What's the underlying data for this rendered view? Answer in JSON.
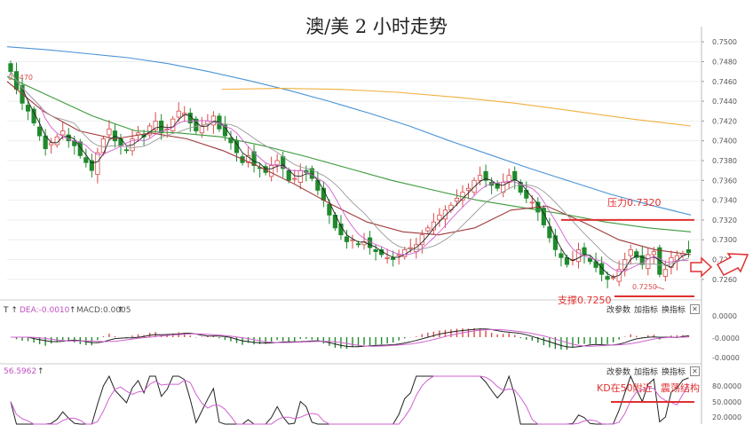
{
  "title": "澳/美 2 小时走势",
  "colors": {
    "up": "#d84a4a",
    "down": "#1f8a2c",
    "red_line": "#e03030",
    "ma_blue": "#4a93d6",
    "ma_orange": "#f0b040",
    "ma_green": "#3a9a3a",
    "ma_darkred": "#a03a3a",
    "ma_pink": "#d060d0",
    "ma_black": "#222222",
    "ma_gray": "#999999"
  },
  "price_panel": {
    "left_label": "0.7470",
    "y_ticks": [
      "0.7500",
      "0.7480",
      "0.7460",
      "0.7440",
      "0.7420",
      "0.7400",
      "0.7380",
      "0.7360",
      "0.7340",
      "0.7320",
      "0.7300",
      "0.7280",
      "0.7260"
    ],
    "resistance_label": "压力0.7320",
    "support_label": "支撑0.7250",
    "low_label": "0.7250"
  },
  "macd_panel": {
    "header": {
      "dea": "DEA:-0.0010",
      "macd": "MACD:0.0005"
    },
    "y_ticks": [
      "0.0000",
      "-0.0000",
      "-0.0000"
    ],
    "toolbar": {
      "params": "改参数",
      "add": "加指标",
      "swap": "换指标",
      "close": "✕"
    }
  },
  "kd_panel": {
    "header_value": "56.5962",
    "y_ticks": [
      "80.0000",
      "50.0000",
      "20.0000"
    ],
    "annotation_kd": "KD在50附近",
    "annotation_range": "震荡结构",
    "toolbar": {
      "params": "改参数",
      "add": "加指标",
      "swap": "换指标",
      "close": "✕"
    }
  },
  "chart_data": [
    {
      "type": "candlestick",
      "title": "澳/美 2 小时走势",
      "ylim": [
        0.725,
        0.751
      ],
      "close": [
        0.747,
        0.7452,
        0.7438,
        0.743,
        0.7418,
        0.7405,
        0.7392,
        0.7398,
        0.7404,
        0.741,
        0.74,
        0.7395,
        0.7385,
        0.7378,
        0.737,
        0.7388,
        0.7402,
        0.7412,
        0.74,
        0.7395,
        0.739,
        0.7402,
        0.7408,
        0.7404,
        0.7415,
        0.742,
        0.7408,
        0.7412,
        0.7422,
        0.743,
        0.7428,
        0.7418,
        0.741,
        0.7415,
        0.742,
        0.7425,
        0.7412,
        0.7405,
        0.7398,
        0.7388,
        0.7378,
        0.7385,
        0.7375,
        0.7372,
        0.7368,
        0.7375,
        0.738,
        0.7372,
        0.736,
        0.7362,
        0.737,
        0.7368,
        0.7362,
        0.735,
        0.734,
        0.7325,
        0.7312,
        0.7305,
        0.7298,
        0.73,
        0.7295,
        0.7298,
        0.7292,
        0.7288,
        0.7285,
        0.7282,
        0.728,
        0.7285,
        0.729,
        0.7292,
        0.7295,
        0.7305,
        0.7312,
        0.7318,
        0.7325,
        0.733,
        0.7335,
        0.7342,
        0.7348,
        0.7352,
        0.736,
        0.7365,
        0.736,
        0.7355,
        0.7352,
        0.7358,
        0.7365,
        0.736,
        0.7348,
        0.7342,
        0.7338,
        0.7328,
        0.7315,
        0.7302,
        0.729,
        0.7282,
        0.7275,
        0.728,
        0.729,
        0.7285,
        0.7278,
        0.7272,
        0.7265,
        0.726,
        0.7262,
        0.727,
        0.728,
        0.729,
        0.7282,
        0.7275,
        0.7285,
        0.7288,
        0.7265,
        0.727,
        0.7282,
        0.7284,
        0.7286,
        0.7287
      ],
      "ma": [
        {
          "name": "",
          "values": [
            0.7495,
            0.7492,
            0.7488,
            0.7484,
            0.7478,
            0.747,
            0.7461,
            0.7451,
            0.744,
            0.7428,
            0.7415,
            0.74,
            0.7386,
            0.7372,
            0.7359,
            0.7346,
            0.7335,
            0.7325
          ]
        },
        {
          "name": "",
          "values": [
            0.7452,
            0.7453,
            0.7452,
            0.7449,
            0.7444,
            0.7438,
            0.743,
            0.7422,
            0.7415
          ]
        },
        {
          "name": "",
          "values": [
            0.7465,
            0.7445,
            0.7425,
            0.741,
            0.7408,
            0.7404,
            0.7395,
            0.7384,
            0.7372,
            0.736,
            0.735,
            0.734,
            0.7333,
            0.7326,
            0.7318,
            0.7312,
            0.7308
          ]
        },
        {
          "name": "",
          "values": [
            0.746,
            0.743,
            0.741,
            0.7402,
            0.7408,
            0.7402,
            0.739,
            0.7374,
            0.7356,
            0.7336,
            0.7318,
            0.7308,
            0.7305,
            0.7312,
            0.733,
            0.7334,
            0.7318,
            0.73,
            0.729,
            0.7285
          ]
        }
      ]
    },
    {
      "type": "macd",
      "series": [
        {
          "name": "DEA",
          "values": [
            -0.001
          ]
        },
        {
          "name": "MACD",
          "values": [
            0.0005
          ]
        }
      ]
    },
    {
      "type": "kd",
      "series": [
        {
          "name": "",
          "values": [
            56.5962
          ]
        }
      ]
    }
  ]
}
